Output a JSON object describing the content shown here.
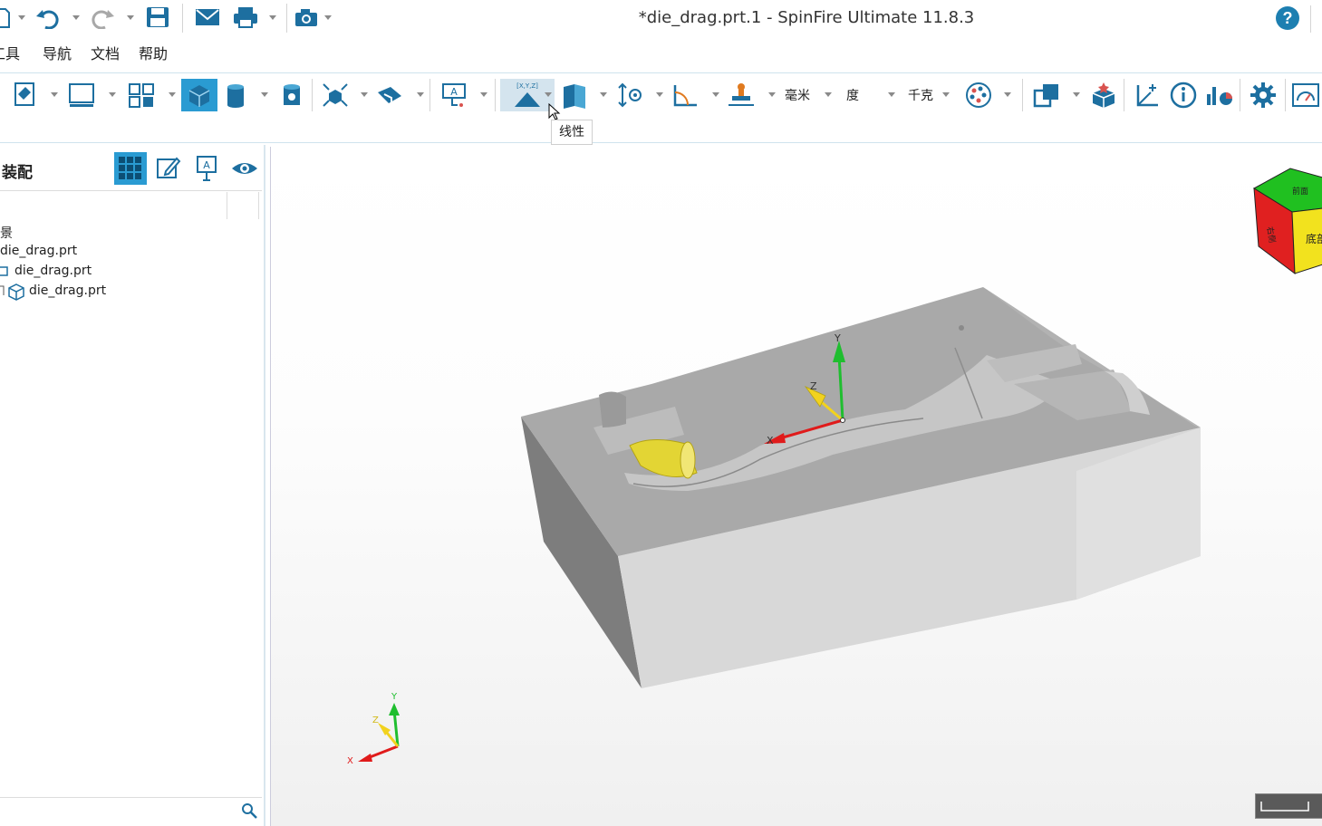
{
  "window": {
    "title": "*die_drag.prt.1 - SpinFire Ultimate 11.8.3",
    "help_label": "?"
  },
  "menu": {
    "items": [
      {
        "label": "工具"
      },
      {
        "label": "导航"
      },
      {
        "label": "文档"
      },
      {
        "label": "帮助"
      }
    ]
  },
  "ribbon": {
    "tooltip": "线性",
    "linear_icon_label": "[X,Y,Z]",
    "units_length": "毫米",
    "units_angle": "度",
    "units_mass": "千克"
  },
  "panel": {
    "title": "装配",
    "tree": [
      {
        "label": "景"
      },
      {
        "label": "die_drag.prt"
      },
      {
        "label": "die_drag.prt"
      },
      {
        "label": "die_drag.prt"
      }
    ]
  },
  "viewport": {
    "triad_labels": {
      "x": "X",
      "y": "Y",
      "z": "Z"
    },
    "viewcube": {
      "top_face": "前面",
      "right_face": "底部",
      "left_face": "右侧"
    },
    "colors": {
      "x_axis": "#e01b1b",
      "y_axis": "#1fbe2f",
      "z_axis": "#f2d21e",
      "part": "#a8a8a8",
      "accent": "#2a9bd2"
    }
  }
}
